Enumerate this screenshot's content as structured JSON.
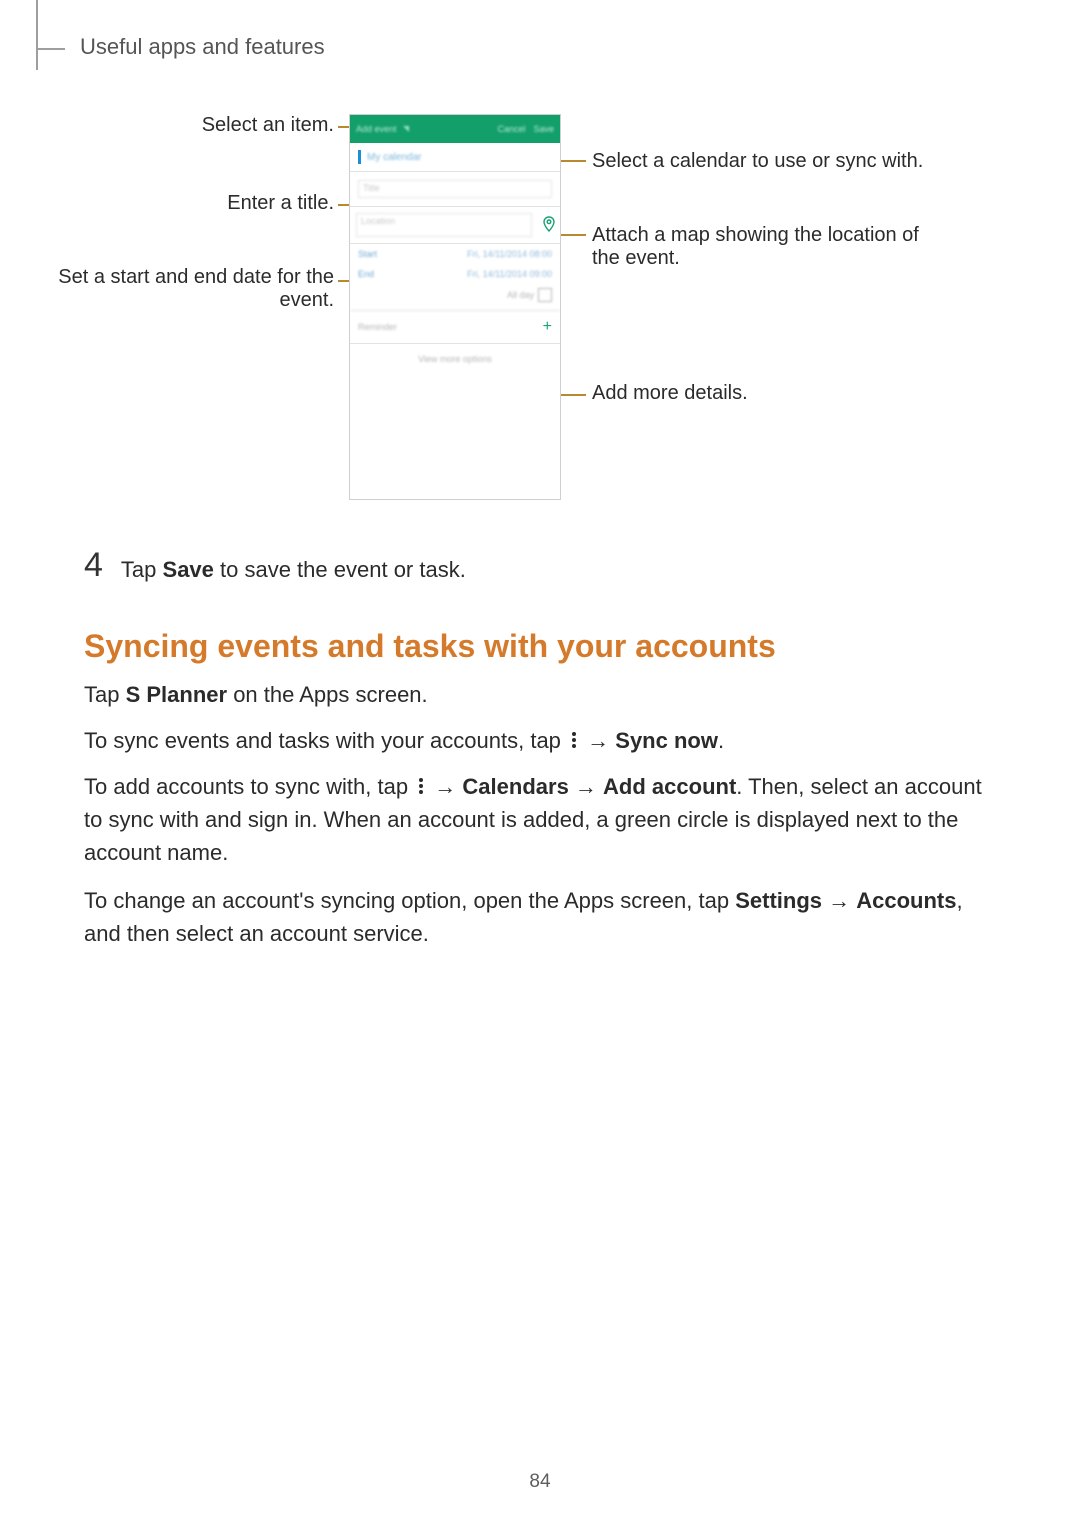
{
  "header": {
    "breadcrumb": "Useful apps and features"
  },
  "callouts": {
    "select_item": "Select an item.",
    "enter_title": "Enter a title.",
    "set_dates": "Set a start and end date for the event.",
    "select_calendar": "Select a calendar to use or sync with.",
    "attach_map": "Attach a map showing the location of the event.",
    "add_details": "Add more details."
  },
  "phone": {
    "topbar_left": "Add event",
    "topbar_cancel": "Cancel",
    "topbar_save": "Save",
    "calendar_name": "My calendar",
    "title_placeholder": "Title",
    "location_placeholder": "Location",
    "start_label": "Start",
    "start_value": "Fri, 14/11/2014   08:00",
    "end_label": "End",
    "end_value": "Fri, 14/11/2014   09:00",
    "allday_label": "All day",
    "reminder_label": "Reminder",
    "more_label": "View more options"
  },
  "step4": {
    "num": "4",
    "prefix": "Tap ",
    "bold": "Save",
    "suffix": " to save the event or task."
  },
  "heading_sync": "Syncing events and tasks with your accounts",
  "p1": {
    "prefix": "Tap ",
    "b1": "S Planner",
    "suffix": " on the Apps screen."
  },
  "p2": {
    "prefix": "To sync events and tasks with your accounts, tap ",
    "arrow": " → ",
    "b1": "Sync now",
    "suffix": "."
  },
  "p3": {
    "prefix": "To add accounts to sync with, tap ",
    "arrow1": " → ",
    "b1": "Calendars",
    "arrow2": " → ",
    "b2": "Add account",
    "suffix": ". Then, select an account to sync with and sign in. When an account is added, a green circle is displayed next to the account name."
  },
  "p4": {
    "prefix": "To change an account's syncing option, open the Apps screen, tap ",
    "b1": "Settings",
    "arrow": " → ",
    "b2": "Accounts",
    "suffix": ", and then select an account service."
  },
  "page_number": "84"
}
